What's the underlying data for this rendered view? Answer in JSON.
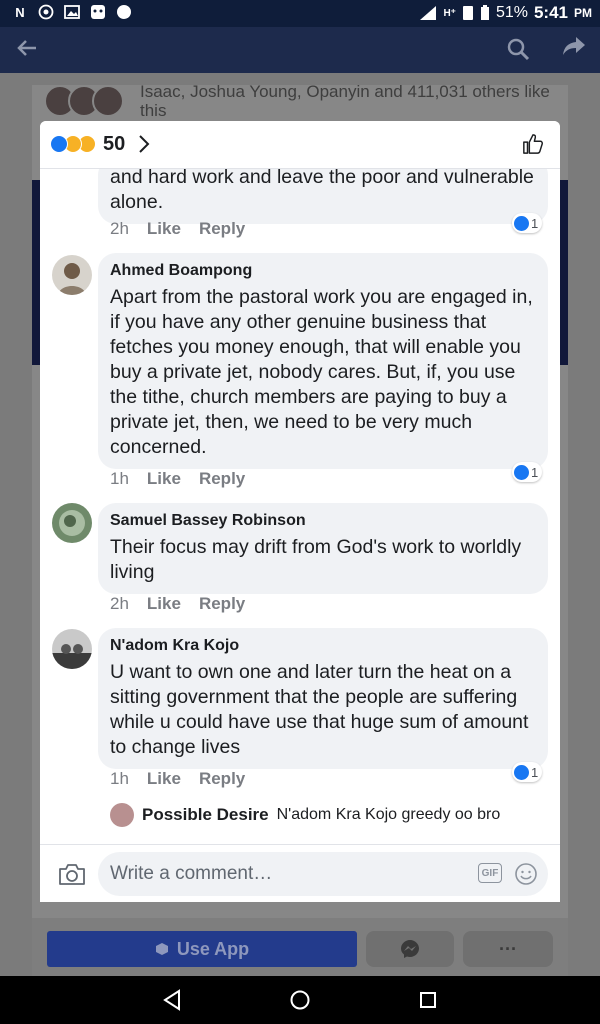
{
  "status_bar": {
    "battery": "51%",
    "time": "5:41",
    "ampm": "PM"
  },
  "background": {
    "reactors_text": "Isaac, Joshua Young, Opanyin and 411,031 others like this",
    "use_app_label": "Use App",
    "more_label": "···"
  },
  "sheet": {
    "reaction_count": "50",
    "comments": [
      {
        "author": "",
        "text": "and hard work and leave the poor and vulnerable alone.",
        "time": "2h",
        "like": "Like",
        "reply": "Reply",
        "reactions": "1"
      },
      {
        "author": "Ahmed Boampong",
        "text": "Apart from the pastoral work you are engaged in, if you have any other genuine business that fetches you money enough, that will enable you buy a private jet, nobody cares. But, if, you use the tithe, church members are paying to buy a private jet, then, we need to be very much concerned.",
        "time": "1h",
        "like": "Like",
        "reply": "Reply",
        "reactions": "1"
      },
      {
        "author": "Samuel Bassey Robinson",
        "text": "Their focus may drift from God's work to worldly living",
        "time": "2h",
        "like": "Like",
        "reply": "Reply"
      },
      {
        "author": "N'adom Kra Kojo",
        "text": "U want to own one and later turn the heat on a sitting government that the people are suffering while u could have use that huge sum of amount to change lives",
        "time": "1h",
        "like": "Like",
        "reply": "Reply",
        "reactions": "1"
      }
    ],
    "reply_preview": {
      "author": "Possible Desire",
      "text": "N'adom Kra Kojo greedy oo bro"
    },
    "composer": {
      "placeholder": "Write a comment…",
      "gif_label": "GIF"
    }
  },
  "colors": {
    "brand": "#1877f2",
    "bubble": "#f0f2f5",
    "status_bar": "#0f1d3a"
  }
}
